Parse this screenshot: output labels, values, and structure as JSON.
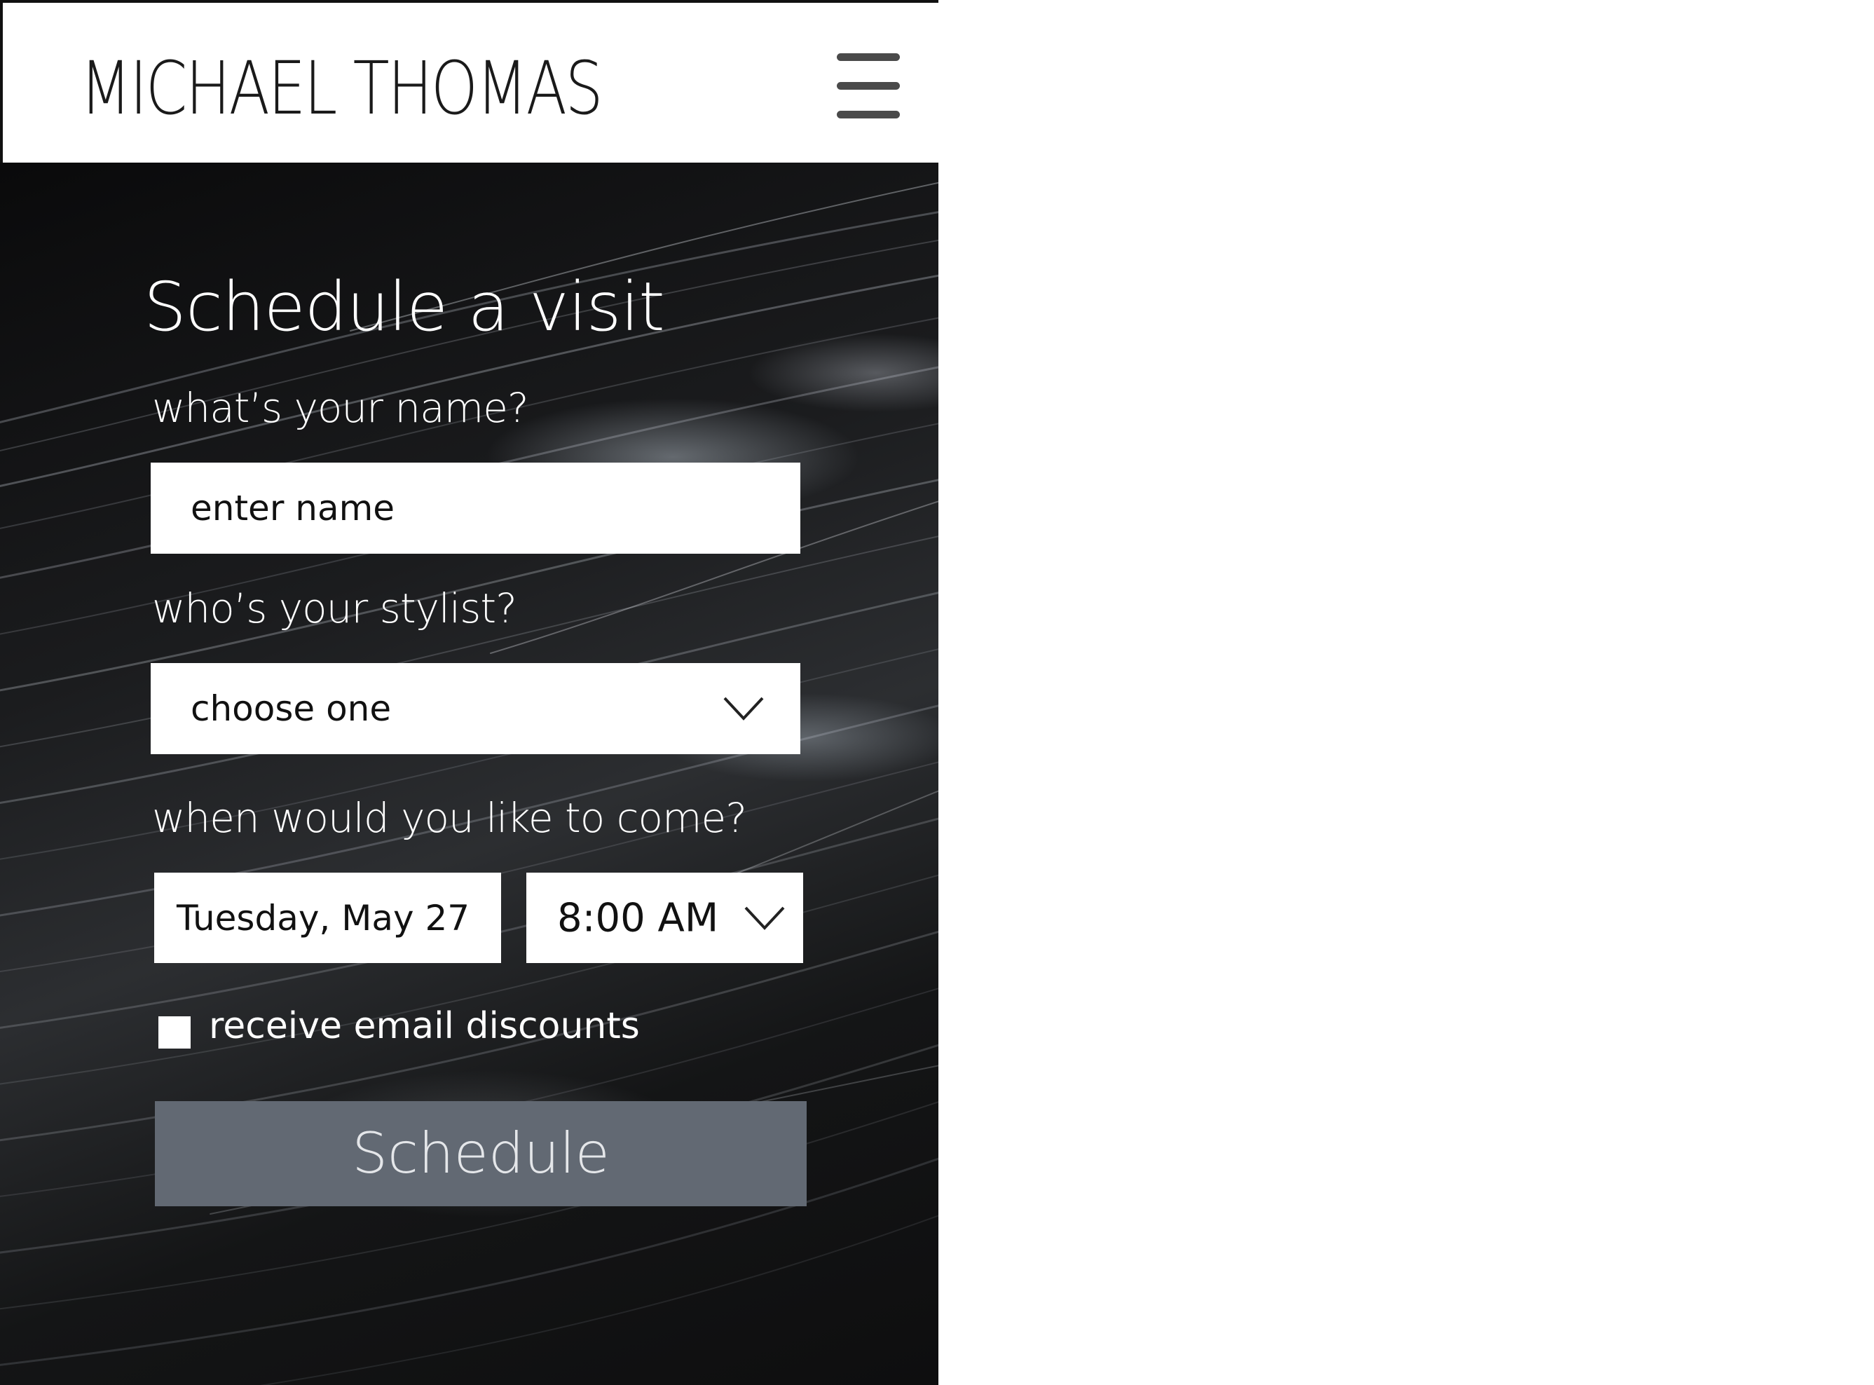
{
  "header": {
    "logo_text": "MICHAEL THOMAS",
    "menu_icon": "hamburger-menu-icon"
  },
  "form": {
    "title": "Schedule a visit",
    "name_label": "what’s your name?",
    "name_placeholder": "enter name",
    "stylist_label": "who’s your stylist?",
    "stylist_value": "choose one",
    "stylist_icon": "chevron-down-icon",
    "when_label": "when would you like to come?",
    "date_value": "Tuesday, May 27",
    "time_value": "8:00 AM",
    "time_icon": "chevron-down-icon",
    "email_discounts_label": "receive email discounts",
    "email_discounts_checked": false,
    "submit_label": "Schedule"
  },
  "colors": {
    "button_bg": "#626973",
    "button_text": "#e4e6e9",
    "field_bg": "#ffffff",
    "label_text": "#ffffff"
  }
}
